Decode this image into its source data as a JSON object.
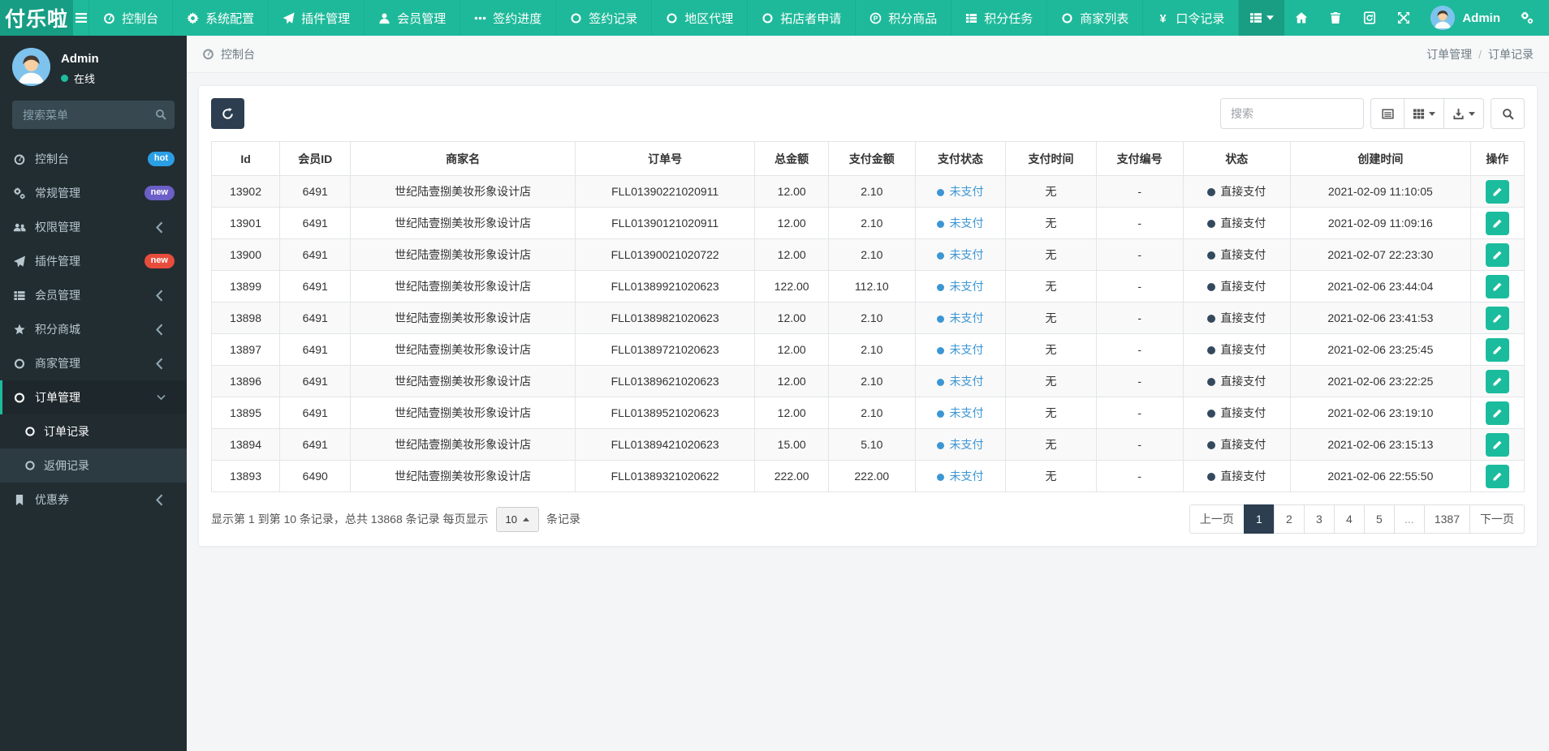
{
  "app": {
    "brand": "付乐啦"
  },
  "colors": {
    "navbar": "#1eb99a",
    "logo_bg": "#179d84",
    "sidebar": "#222d32",
    "active_menu_bar": "#1ebc9c",
    "refresh_btn": "#2c3e50",
    "edit_btn": "#1bbc9d",
    "pay_status_blue": "#3c96d4",
    "status_dot": "#34495e",
    "active_page": "#2c3e50",
    "badge_hot": "#2b9fe5",
    "badge_new_purple": "#6c5fc7",
    "badge_new_red": "#e74c3c"
  },
  "navbar": {
    "menu": [
      {
        "icon": "gauge",
        "label": "控制台"
      },
      {
        "icon": "gear",
        "label": "系统配置"
      },
      {
        "icon": "plane",
        "label": "插件管理"
      },
      {
        "icon": "user",
        "label": "会员管理"
      },
      {
        "icon": "ellipsis",
        "label": "签约进度"
      },
      {
        "icon": "ring",
        "label": "签约记录"
      },
      {
        "icon": "ring",
        "label": "地区代理"
      },
      {
        "icon": "ring",
        "label": "拓店者申请"
      },
      {
        "icon": "pcircle",
        "label": "积分商品"
      },
      {
        "icon": "thlist",
        "label": "积分任务"
      },
      {
        "icon": "ring",
        "label": "商家列表"
      },
      {
        "icon": "yen",
        "label": "口令记录"
      }
    ],
    "right_icons": [
      {
        "icon": "thlist",
        "name": "view-menu",
        "caret": true,
        "dark": true
      },
      {
        "icon": "home",
        "name": "home"
      },
      {
        "icon": "trash",
        "name": "trash"
      },
      {
        "icon": "cache",
        "name": "clear-cache"
      },
      {
        "icon": "expand",
        "name": "fullscreen"
      }
    ],
    "user_name": "Admin"
  },
  "sidebar": {
    "user": {
      "name": "Admin",
      "status": "在线"
    },
    "search_placeholder": "搜索菜单",
    "items": [
      {
        "icon": "gauge",
        "label": "控制台",
        "badge": "hot",
        "badge_color": "#2b9fe5"
      },
      {
        "icon": "gears",
        "label": "常规管理",
        "badge": "new",
        "badge_color": "#6c5fc7"
      },
      {
        "icon": "users",
        "label": "权限管理",
        "chevron": true
      },
      {
        "icon": "plane",
        "label": "插件管理",
        "badge": "new",
        "badge_color": "#e74c3c"
      },
      {
        "icon": "thlist",
        "label": "会员管理",
        "chevron": true
      },
      {
        "icon": "star",
        "label": "积分商城",
        "chevron": true
      },
      {
        "icon": "ring",
        "label": "商家管理",
        "chevron": true
      },
      {
        "icon": "ring",
        "label": "订单管理",
        "active": true,
        "expanded": true,
        "children": [
          {
            "icon": "ring",
            "label": "订单记录",
            "active": true
          },
          {
            "icon": "ring",
            "label": "返佣记录"
          }
        ]
      },
      {
        "icon": "bookmark",
        "label": "优惠券",
        "chevron": true
      }
    ]
  },
  "breadcrumb": {
    "section": "控制台",
    "trail": [
      "订单管理",
      "订单记录"
    ],
    "separator": "/"
  },
  "toolbar": {
    "search_placeholder": "搜索"
  },
  "table": {
    "headers": [
      "Id",
      "会员ID",
      "商家名",
      "订单号",
      "总金额",
      "支付金额",
      "支付状态",
      "支付时间",
      "支付编号",
      "状态",
      "创建时间",
      "操作"
    ],
    "rows": [
      {
        "id": "13902",
        "member_id": "6491",
        "merchant": "世纪陆壹捌美妆形象设计店",
        "order_no": "FLL01390221020911",
        "total": "12.00",
        "paid": "2.10",
        "pay_status": "未支付",
        "pay_time": "无",
        "pay_no": "-",
        "status": "直接支付",
        "created": "2021-02-09 11:10:05"
      },
      {
        "id": "13901",
        "member_id": "6491",
        "merchant": "世纪陆壹捌美妆形象设计店",
        "order_no": "FLL01390121020911",
        "total": "12.00",
        "paid": "2.10",
        "pay_status": "未支付",
        "pay_time": "无",
        "pay_no": "-",
        "status": "直接支付",
        "created": "2021-02-09 11:09:16"
      },
      {
        "id": "13900",
        "member_id": "6491",
        "merchant": "世纪陆壹捌美妆形象设计店",
        "order_no": "FLL01390021020722",
        "total": "12.00",
        "paid": "2.10",
        "pay_status": "未支付",
        "pay_time": "无",
        "pay_no": "-",
        "status": "直接支付",
        "created": "2021-02-07 22:23:30"
      },
      {
        "id": "13899",
        "member_id": "6491",
        "merchant": "世纪陆壹捌美妆形象设计店",
        "order_no": "FLL01389921020623",
        "total": "122.00",
        "paid": "112.10",
        "pay_status": "未支付",
        "pay_time": "无",
        "pay_no": "-",
        "status": "直接支付",
        "created": "2021-02-06 23:44:04"
      },
      {
        "id": "13898",
        "member_id": "6491",
        "merchant": "世纪陆壹捌美妆形象设计店",
        "order_no": "FLL01389821020623",
        "total": "12.00",
        "paid": "2.10",
        "pay_status": "未支付",
        "pay_time": "无",
        "pay_no": "-",
        "status": "直接支付",
        "created": "2021-02-06 23:41:53"
      },
      {
        "id": "13897",
        "member_id": "6491",
        "merchant": "世纪陆壹捌美妆形象设计店",
        "order_no": "FLL01389721020623",
        "total": "12.00",
        "paid": "2.10",
        "pay_status": "未支付",
        "pay_time": "无",
        "pay_no": "-",
        "status": "直接支付",
        "created": "2021-02-06 23:25:45"
      },
      {
        "id": "13896",
        "member_id": "6491",
        "merchant": "世纪陆壹捌美妆形象设计店",
        "order_no": "FLL01389621020623",
        "total": "12.00",
        "paid": "2.10",
        "pay_status": "未支付",
        "pay_time": "无",
        "pay_no": "-",
        "status": "直接支付",
        "created": "2021-02-06 23:22:25"
      },
      {
        "id": "13895",
        "member_id": "6491",
        "merchant": "世纪陆壹捌美妆形象设计店",
        "order_no": "FLL01389521020623",
        "total": "12.00",
        "paid": "2.10",
        "pay_status": "未支付",
        "pay_time": "无",
        "pay_no": "-",
        "status": "直接支付",
        "created": "2021-02-06 23:19:10"
      },
      {
        "id": "13894",
        "member_id": "6491",
        "merchant": "世纪陆壹捌美妆形象设计店",
        "order_no": "FLL01389421020623",
        "total": "15.00",
        "paid": "5.10",
        "pay_status": "未支付",
        "pay_time": "无",
        "pay_no": "-",
        "status": "直接支付",
        "created": "2021-02-06 23:15:13"
      },
      {
        "id": "13893",
        "member_id": "6490",
        "merchant": "世纪陆壹捌美妆形象设计店",
        "order_no": "FLL01389321020622",
        "total": "222.00",
        "paid": "222.00",
        "pay_status": "未支付",
        "pay_time": "无",
        "pay_no": "-",
        "status": "直接支付",
        "created": "2021-02-06 22:55:50"
      }
    ]
  },
  "pagination": {
    "summary_before": "显示第 1 到第 10 条记录，总共 13868 条记录 每页显示",
    "page_size": "10",
    "summary_after": "条记录",
    "prev": "上一页",
    "next": "下一页",
    "pages": [
      "1",
      "2",
      "3",
      "4",
      "5",
      "...",
      "1387"
    ],
    "active": "1"
  }
}
